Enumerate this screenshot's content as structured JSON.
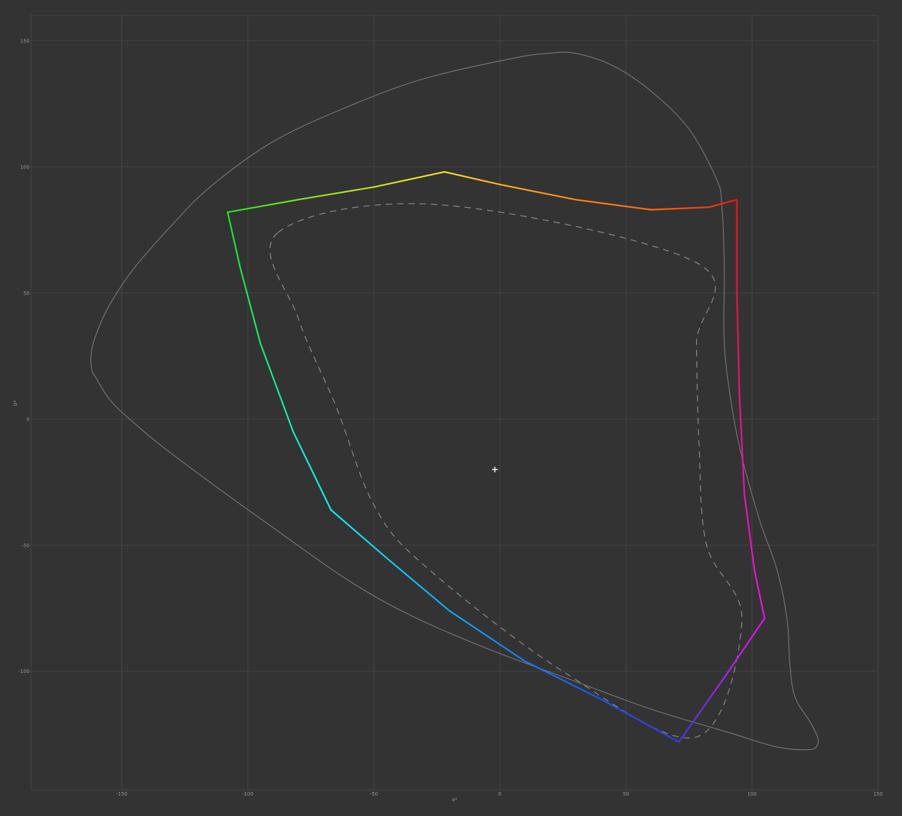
{
  "chart_data": {
    "type": "line",
    "title": "",
    "xlabel": "a*",
    "ylabel": "b*",
    "xlim": [
      -186,
      150
    ],
    "ylim": [
      -147,
      160
    ],
    "xticks": [
      -150,
      -100,
      -50,
      0,
      50,
      100,
      150
    ],
    "yticks": [
      150,
      100,
      50,
      0,
      -50,
      -100
    ],
    "grid": true,
    "colors": {
      "background": "#333333",
      "grid": "#444444",
      "locus": "#7a7a7a",
      "dashed": "#8c8c8c",
      "tick_text": "#9a9a9a"
    },
    "series": [
      {
        "style": "solid-gray",
        "closed": true,
        "points": [
          [
            19,
            145
          ],
          [
            5,
            143
          ],
          [
            -30,
            135
          ],
          [
            -60,
            124
          ],
          [
            -90,
            110
          ],
          [
            -115,
            92
          ],
          [
            -130,
            77
          ],
          [
            -145,
            60
          ],
          [
            -155,
            45
          ],
          [
            -160,
            34
          ],
          [
            -162,
            27
          ],
          [
            -162,
            20
          ],
          [
            -160,
            16
          ],
          [
            -155,
            8
          ],
          [
            -148,
            1
          ],
          [
            -135,
            -10
          ],
          [
            -115,
            -25
          ],
          [
            -90,
            -43
          ],
          [
            -60,
            -64
          ],
          [
            -35,
            -78
          ],
          [
            -5,
            -91
          ],
          [
            30,
            -104
          ],
          [
            60,
            -115
          ],
          [
            90,
            -124
          ],
          [
            110,
            -130
          ],
          [
            123,
            -131
          ],
          [
            126,
            -129
          ],
          [
            126,
            -126
          ],
          [
            123,
            -120
          ],
          [
            117,
            -110
          ],
          [
            115,
            -97
          ],
          [
            114,
            -80
          ],
          [
            110,
            -60
          ],
          [
            103,
            -40
          ],
          [
            96,
            -15
          ],
          [
            92,
            5
          ],
          [
            89,
            30
          ],
          [
            89,
            60
          ],
          [
            88,
            85
          ],
          [
            86,
            95
          ],
          [
            75,
            115
          ],
          [
            60,
            130
          ],
          [
            45,
            140
          ],
          [
            30,
            145
          ]
        ]
      },
      {
        "style": "dashed-gray",
        "closed": true,
        "points": [
          [
            -88,
            74
          ],
          [
            -24,
            85
          ],
          [
            78,
            62
          ],
          [
            78,
            30
          ],
          [
            79,
            -10
          ],
          [
            82,
            -50
          ],
          [
            96,
            -80
          ],
          [
            78,
            -126
          ],
          [
            25,
            -100
          ],
          [
            -30,
            -58
          ],
          [
            -50,
            -34
          ],
          [
            -65,
            5
          ],
          [
            -80,
            40
          ]
        ]
      },
      {
        "style": "gradient",
        "closed": true,
        "points": [
          {
            "a": -22,
            "b": 98,
            "color": "#ffe126"
          },
          {
            "a": 0,
            "b": 93,
            "color": "#ffb11a"
          },
          {
            "a": 30,
            "b": 87,
            "color": "#ff8a12"
          },
          {
            "a": 60,
            "b": 83,
            "color": "#ff6a10"
          },
          {
            "a": 83,
            "b": 84,
            "color": "#ff3a10"
          },
          {
            "a": 94,
            "b": 87,
            "color": "#ff1010"
          },
          {
            "a": 94,
            "b": 50,
            "color": "#f0103a"
          },
          {
            "a": 95,
            "b": 10,
            "color": "#f01080"
          },
          {
            "a": 97,
            "b": -30,
            "color": "#f010b8"
          },
          {
            "a": 101,
            "b": -60,
            "color": "#f010d8"
          },
          {
            "a": 105,
            "b": -79,
            "color": "#ee10ee"
          },
          {
            "a": 90,
            "b": -101,
            "color": "#b020f0"
          },
          {
            "a": 71,
            "b": -128,
            "color": "#3a3ae6"
          },
          {
            "a": 40,
            "b": -111,
            "color": "#1a54f0"
          },
          {
            "a": 10,
            "b": -96,
            "color": "#1a7af0"
          },
          {
            "a": -20,
            "b": -76,
            "color": "#10a8f8"
          },
          {
            "a": -45,
            "b": -55,
            "color": "#10d0f8"
          },
          {
            "a": -67,
            "b": -36,
            "color": "#10f0f0"
          },
          {
            "a": -82,
            "b": -5,
            "color": "#10f0c0"
          },
          {
            "a": -95,
            "b": 30,
            "color": "#10ee70"
          },
          {
            "a": -103,
            "b": 60,
            "color": "#14ea40"
          },
          {
            "a": -108,
            "b": 82,
            "color": "#1ae81a"
          },
          {
            "a": -80,
            "b": 87,
            "color": "#7ee61e"
          },
          {
            "a": -50,
            "b": 92,
            "color": "#c8e420"
          }
        ]
      }
    ],
    "white_point_marker": {
      "a": -2,
      "b": -20,
      "symbol": "+"
    }
  }
}
